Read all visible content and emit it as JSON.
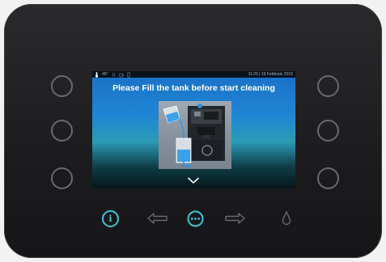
{
  "status_bar": {
    "temperature": "45°",
    "datetime": "11:25 | 19 Febbraio 2015"
  },
  "screen": {
    "message": "Please Fill the tank before start cleaning",
    "illustration_icon": "fill-tank-illustration",
    "scroll_icon": "chevron-down-icon"
  },
  "bottom_bar": {
    "info_label": "i",
    "menu_icon": "ellipsis-icon",
    "back_icon": "arrow-left-icon",
    "forward_icon": "arrow-right-icon",
    "water_icon": "drop-icon"
  },
  "colors": {
    "accent": "#3ec6d6",
    "panel": "#1c1c1e",
    "button_outline": "#6a6a6e",
    "inactive_icon": "#6a6a6e"
  }
}
